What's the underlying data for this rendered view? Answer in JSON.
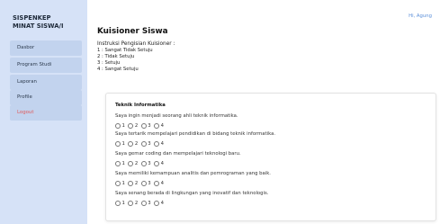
{
  "sidebar": {
    "brand_line1": "SISPENKEP",
    "brand_line2": "MINAT SISWA/I",
    "items": [
      {
        "label": "Dasbor"
      },
      {
        "label": "Program Studi"
      },
      {
        "label": "Laporan"
      },
      {
        "label": "Profile"
      },
      {
        "label": "Logout"
      }
    ]
  },
  "header": {
    "greeting": "Hi, Agung"
  },
  "main": {
    "title": "Kuisioner Siswa",
    "instructions_title": "Instruksi Pengisian Kuisioner :",
    "scale": [
      "1 : Sangat Tidak Setuju",
      "2 : Tidak Setuju",
      "3 : Setuju",
      "4 : Sangat Setuju"
    ],
    "section": {
      "title": "Teknik Informatika",
      "questions": [
        {
          "text": "Saya ingin menjadi seorang ahli teknik informatika."
        },
        {
          "text": "Saya tertarik mempelajari pendidikan di bidang teknik informatika."
        },
        {
          "text": "Saya gemar coding dan mempelajari teknologi baru."
        },
        {
          "text": "Saya memiliki kemampuan analitis dan pemrograman yang baik."
        },
        {
          "text": "Saya senang berada di lingkungan yang inovatif dan teknologis."
        }
      ],
      "options": [
        "1",
        "2",
        "3",
        "4"
      ]
    }
  },
  "colors": {
    "sidebar_bg": "#d6e2f7",
    "nav_item_bg": "#c2d3ee",
    "logout_text": "#e05a5a",
    "greeting_text": "#5b8fd9"
  }
}
